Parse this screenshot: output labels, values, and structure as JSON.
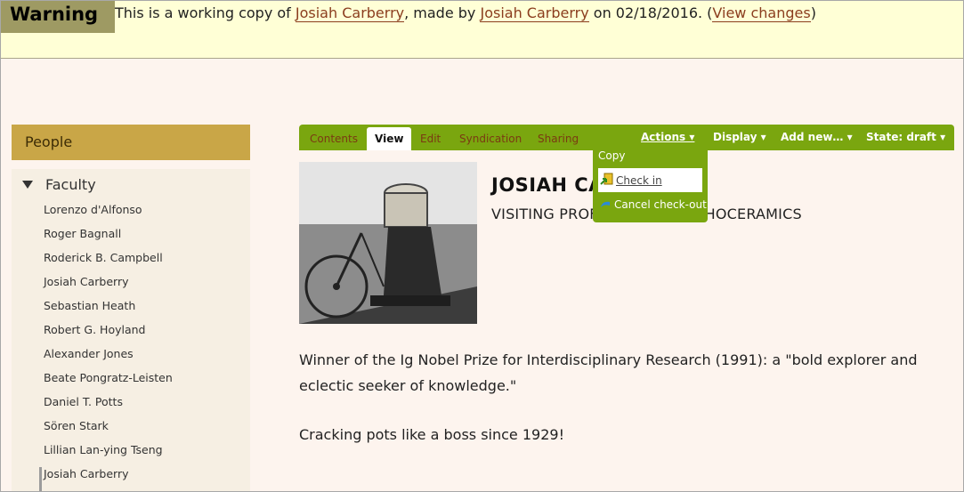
{
  "warning": {
    "badge": "Warning",
    "text_before": "This is a working copy of ",
    "author_link": "Josiah Carberry",
    "text_middle": ", made by ",
    "editor_link": "Josiah Carberry",
    "text_date": " on 02/18/2016. (",
    "view_changes": "View changes",
    "text_end": ")"
  },
  "sidebar": {
    "header": "People",
    "section": "Faculty",
    "people": [
      "Lorenzo d'Alfonso",
      "Roger Bagnall",
      "Roderick B. Campbell",
      "Josiah Carberry",
      "Sebastian Heath",
      "Robert G. Hoyland",
      "Alexander Jones",
      "Beate Pongratz-Leisten",
      "Daniel T. Potts",
      "Sören Stark",
      "Lillian Lan-ying Tseng",
      "Josiah Carberry"
    ]
  },
  "toolbar": {
    "tabs": [
      "Contents",
      "View",
      "Edit",
      "Syndication",
      "Sharing"
    ],
    "active_tab": "View",
    "actions": "Actions ▾",
    "display": "Display ▾",
    "add_new": "Add new… ▾",
    "state": "State: draft ▾"
  },
  "actions_menu": {
    "copy": "Copy",
    "check_in": "Check in",
    "cancel_checkout": "Cancel check-out"
  },
  "profile": {
    "name": "JOSIAH CA",
    "title": "VISITING PROF",
    "title_tail": "HOCERAMICS",
    "bio": [
      "Winner of the Ig Nobel Prize for Interdisciplinary Research (1991): a \"bold explorer and eclectic seeker of knowledge.\"",
      "Cracking pots like a boss since 1929!"
    ]
  },
  "colors": {
    "toolbar_green": "#7aa60f",
    "sidebar_header": "#c9a647",
    "warning_bg": "#ffffd6",
    "link": "#8b3d1e"
  }
}
